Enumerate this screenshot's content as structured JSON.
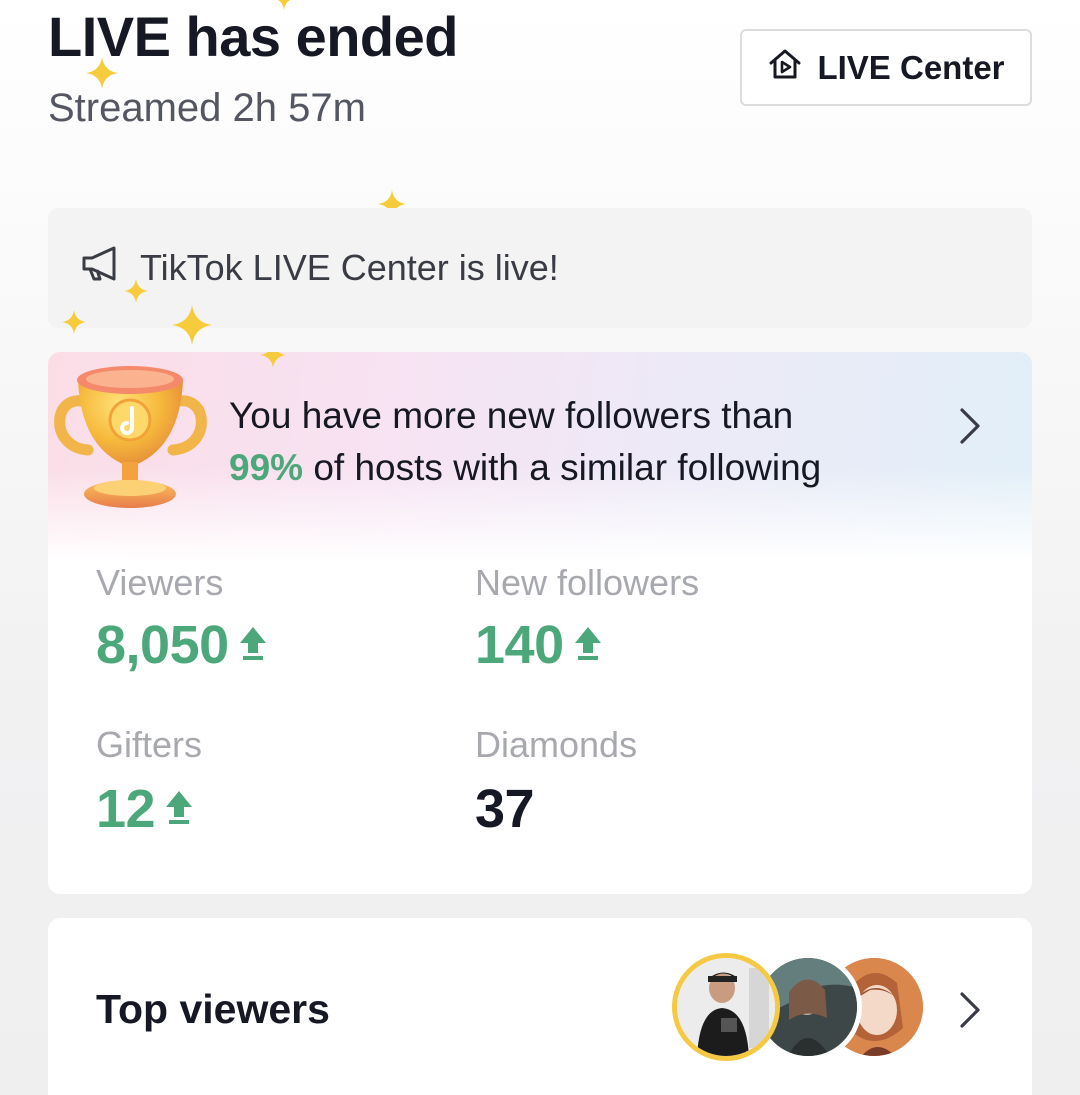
{
  "header": {
    "title": "LIVE has ended",
    "subtitle": "Streamed 2h 57m",
    "live_center_button": "LIVE Center"
  },
  "announcement": {
    "text": "TikTok LIVE Center is live!",
    "icon": "megaphone-icon"
  },
  "banner": {
    "text_before": "You have more new followers than",
    "highlight": "99%",
    "text_after": " of hosts with a similar following",
    "icon": "trophy-icon"
  },
  "stats": [
    {
      "label": "Viewers",
      "value": "8,050",
      "trend": "up"
    },
    {
      "label": "New followers",
      "value": "140",
      "trend": "up"
    },
    {
      "label": "Gifters",
      "value": "12",
      "trend": "up"
    },
    {
      "label": "Diamonds",
      "value": "37",
      "trend": "none"
    }
  ],
  "top_viewers": {
    "label": "Top viewers",
    "avatars": [
      "avatar-1",
      "avatar-2",
      "avatar-3"
    ]
  },
  "colors": {
    "accent_green": "#4ca87a",
    "text_primary": "#161823",
    "sparkle": "#f7cc3c"
  }
}
